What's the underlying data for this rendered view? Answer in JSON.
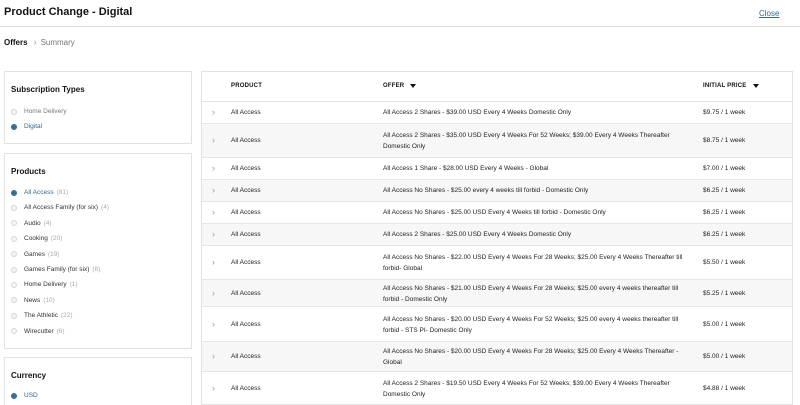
{
  "header": {
    "title": "Product Change - Digital",
    "close_label": "Close"
  },
  "breadcrumb": {
    "current": "Offers",
    "next": "Summary"
  },
  "subscription_types": {
    "title": "Subscription Types",
    "items": [
      {
        "label": "Home Delivery",
        "selected": false
      },
      {
        "label": "Digital",
        "selected": true
      }
    ]
  },
  "products": {
    "title": "Products",
    "items": [
      {
        "label": "All Access",
        "count": "(81)",
        "selected": true
      },
      {
        "label": "All Access Family (for six)",
        "count": "(4)",
        "selected": false
      },
      {
        "label": "Audio",
        "count": "(4)",
        "selected": false
      },
      {
        "label": "Cooking",
        "count": "(20)",
        "selected": false
      },
      {
        "label": "Games",
        "count": "(19)",
        "selected": false
      },
      {
        "label": "Games Family (for six)",
        "count": "(8)",
        "selected": false
      },
      {
        "label": "Home Delivery",
        "count": "(1)",
        "selected": false
      },
      {
        "label": "News",
        "count": "(10)",
        "selected": false
      },
      {
        "label": "The Athletic",
        "count": "(22)",
        "selected": false
      },
      {
        "label": "Wirecutter",
        "count": "(6)",
        "selected": false
      }
    ]
  },
  "currency": {
    "title": "Currency",
    "items": [
      {
        "label": "USD",
        "selected": true
      }
    ]
  },
  "table": {
    "columns": {
      "product": "PRODUCT",
      "offer": "OFFER",
      "price": "INITIAL PRICE"
    },
    "rows": [
      {
        "product": "All Access",
        "offer": "All Access 2 Shares - $39.00 USD Every 4 Weeks Domestic Only",
        "price": "$9.75 / 1 week"
      },
      {
        "product": "All Access",
        "offer": "All Access 2 Shares - $35.00 USD Every 4 Weeks For 52 Weeks; $39.00 Every 4 Weeks Thereafter Domestic Only",
        "price": "$8.75 / 1 week"
      },
      {
        "product": "All Access",
        "offer": "All Access 1 Share - $28.00 USD Every 4 Weeks - Global",
        "price": "$7.00 / 1 week"
      },
      {
        "product": "All Access",
        "offer": "All Access No Shares - $25.00 every 4 weeks till forbid - Domestic Only",
        "price": "$6.25 / 1 week"
      },
      {
        "product": "All Access",
        "offer": "All Access No Shares - $25.00 USD Every 4 Weeks till forbid - Domestic Only",
        "price": "$6.25 / 1 week"
      },
      {
        "product": "All Access",
        "offer": "All Access 2 Shares - $25.00 USD Every 4 Weeks Domestic Only",
        "price": "$6.25 / 1 week"
      },
      {
        "product": "All Access",
        "offer": "All Access No Shares - $22.00 USD Every 4 Weeks For 28 Weeks; $25.00 Every 4 Weeks Thereafter till forbid- Global",
        "price": "$5.50 / 1 week"
      },
      {
        "product": "All Access",
        "offer": "All Access No Shares - $21.00 USD Every 4 Weeks For 28 Weeks; $25.00 every 4 weeks thereafter till forbid - Domestic Only",
        "price": "$5.25 / 1 week"
      },
      {
        "product": "All Access",
        "offer": "All Access No Shares - $20.00 USD Every 4 Weeks For 52 Weeks; $25.00 every 4 weeks thereafter till forbid - STS PI- Domestic Only",
        "price": "$5.00 / 1 week"
      },
      {
        "product": "All Access",
        "offer": "All Access No Shares - $20.00 USD Every 4 Weeks For 28 Weeks; $25.00 Every 4 Weeks Thereafter - Global",
        "price": "$5.00 / 1 week"
      },
      {
        "product": "All Access",
        "offer": "All Access 2 Shares - $19.50 USD Every 4 Weeks For 52 Weeks; $39.00 Every 4 Weeks Thereafter Domestic Only",
        "price": "$4.88 / 1 week"
      }
    ]
  }
}
